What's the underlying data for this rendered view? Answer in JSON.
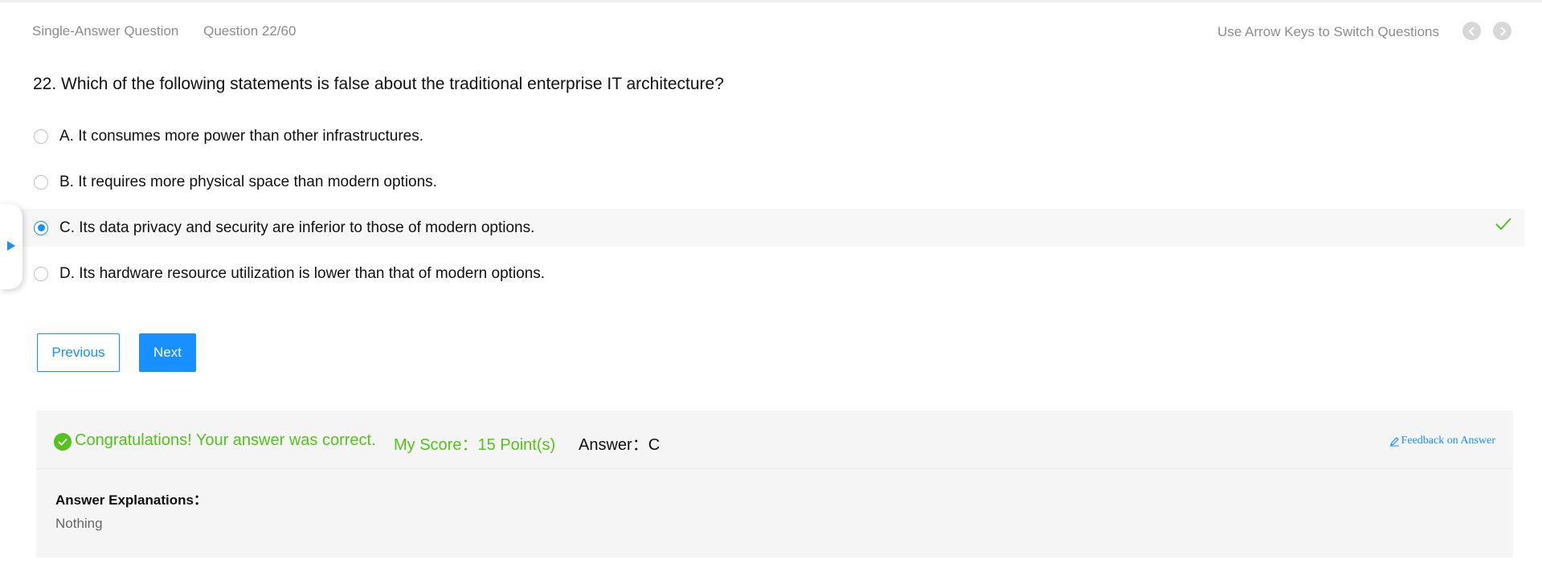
{
  "header": {
    "question_type": "Single-Answer Question",
    "progress": "Question 22/60",
    "hint": "Use Arrow Keys to Switch Questions"
  },
  "question": {
    "text": "22. Which of the following statements is false about the traditional enterprise IT architecture?",
    "options": [
      {
        "label": "A. It consumes more power than other infrastructures.",
        "selected": false
      },
      {
        "label": "B. It requires more physical space than modern options.",
        "selected": false
      },
      {
        "label": "C. Its data privacy and security are inferior to those of modern options.",
        "selected": true,
        "correct": true
      },
      {
        "label": "D. Its hardware resource utilization is lower than that of modern options.",
        "selected": false
      }
    ]
  },
  "buttons": {
    "previous": "Previous",
    "next": "Next"
  },
  "result": {
    "congrats": "Congratulations! Your answer was correct.",
    "score": "My Score：15 Point(s)",
    "answer": "Answer：C",
    "feedback": "Feedback on Answer",
    "explanation_title": "Answer Explanations：",
    "explanation_text": "Nothing"
  },
  "colors": {
    "accent": "#1890ff",
    "success": "#52c41a",
    "muted": "#8c8c8c"
  },
  "icons": [
    "chevron-left-icon",
    "chevron-right-icon",
    "checkmark-icon",
    "check-circle-icon",
    "edit-pen-icon",
    "expand-triangle-icon"
  ]
}
